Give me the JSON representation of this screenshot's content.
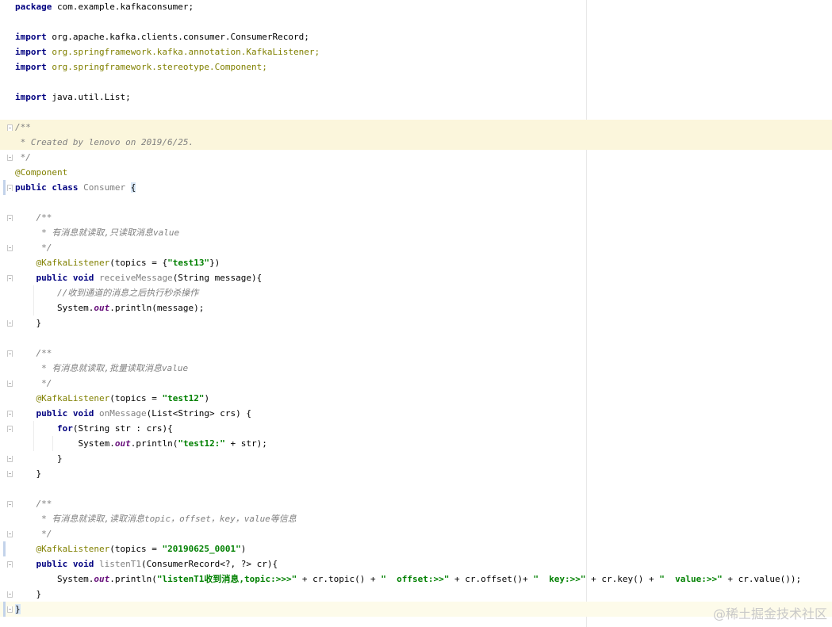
{
  "editor": {
    "lines": [
      [
        {
          "t": "package ",
          "c": "kw"
        },
        {
          "t": "com.example.kafkaconsumer;",
          "c": "plain"
        }
      ],
      [],
      [
        {
          "t": "import ",
          "c": "kw"
        },
        {
          "t": "org.apache.kafka.clients.consumer.ConsumerRecord;",
          "c": "plain"
        }
      ],
      [
        {
          "t": "import ",
          "c": "kw"
        },
        {
          "t": "org.springframework.kafka.annotation.KafkaListener;",
          "c": "anno"
        }
      ],
      [
        {
          "t": "import ",
          "c": "kw"
        },
        {
          "t": "org.springframework.stereotype.Component;",
          "c": "anno"
        }
      ],
      [],
      [
        {
          "t": "import ",
          "c": "kw"
        },
        {
          "t": "java.util.List;",
          "c": "plain"
        }
      ],
      [],
      [
        {
          "t": "/**",
          "c": "comment"
        }
      ],
      [
        {
          "t": " * Created by lenovo on 2019/6/25.",
          "c": "comment"
        }
      ],
      [
        {
          "t": " */",
          "c": "comment"
        }
      ],
      [
        {
          "t": "@Component",
          "c": "anno"
        }
      ],
      [
        {
          "t": "public class ",
          "c": "kw"
        },
        {
          "t": "Consumer ",
          "c": "unused"
        },
        {
          "t": "{",
          "c": "brace"
        }
      ],
      [],
      [
        {
          "t": "    /**",
          "c": "comment"
        }
      ],
      [
        {
          "t": "     * 有消息就读取,只读取消息value",
          "c": "comment"
        }
      ],
      [
        {
          "t": "     */",
          "c": "comment"
        }
      ],
      [
        {
          "t": "    @KafkaListener",
          "c": "anno"
        },
        {
          "t": "(topics = {",
          "c": "plain"
        },
        {
          "t": "\"test13\"",
          "c": "str"
        },
        {
          "t": "})",
          "c": "plain"
        }
      ],
      [
        {
          "t": "    public void ",
          "c": "kw"
        },
        {
          "t": "receiveMessage",
          "c": "unused"
        },
        {
          "t": "(String message){",
          "c": "plain"
        }
      ],
      [
        {
          "t": "        //收到通道的消息之后执行秒杀操作",
          "c": "comment"
        }
      ],
      [
        {
          "t": "        System.",
          "c": "plain"
        },
        {
          "t": "out",
          "c": "static"
        },
        {
          "t": ".println(message);",
          "c": "plain"
        }
      ],
      [
        {
          "t": "    }",
          "c": "plain"
        }
      ],
      [],
      [
        {
          "t": "    /**",
          "c": "comment"
        }
      ],
      [
        {
          "t": "     * 有消息就读取,批量读取消息value",
          "c": "comment"
        }
      ],
      [
        {
          "t": "     */",
          "c": "comment"
        }
      ],
      [
        {
          "t": "    @KafkaListener",
          "c": "anno"
        },
        {
          "t": "(topics = ",
          "c": "plain"
        },
        {
          "t": "\"test12\"",
          "c": "str"
        },
        {
          "t": ")",
          "c": "plain"
        }
      ],
      [
        {
          "t": "    public void ",
          "c": "kw"
        },
        {
          "t": "onMessage",
          "c": "unused"
        },
        {
          "t": "(List<String> crs) {",
          "c": "plain"
        }
      ],
      [
        {
          "t": "        ",
          "c": "plain"
        },
        {
          "t": "for",
          "c": "kw"
        },
        {
          "t": "(String str : crs){",
          "c": "plain"
        }
      ],
      [
        {
          "t": "            System.",
          "c": "plain"
        },
        {
          "t": "out",
          "c": "static"
        },
        {
          "t": ".println(",
          "c": "plain"
        },
        {
          "t": "\"test12:\"",
          "c": "str"
        },
        {
          "t": " + str);",
          "c": "plain"
        }
      ],
      [
        {
          "t": "        }",
          "c": "plain"
        }
      ],
      [
        {
          "t": "    }",
          "c": "plain"
        }
      ],
      [],
      [
        {
          "t": "    /**",
          "c": "comment"
        }
      ],
      [
        {
          "t": "     * 有消息就读取,读取消息topic，offset，key，value等信息",
          "c": "comment"
        }
      ],
      [
        {
          "t": "     */",
          "c": "comment"
        }
      ],
      [
        {
          "t": "    @KafkaListener",
          "c": "anno"
        },
        {
          "t": "(topics = ",
          "c": "plain"
        },
        {
          "t": "\"20190625_0001\"",
          "c": "str"
        },
        {
          "t": ")",
          "c": "plain"
        }
      ],
      [
        {
          "t": "    public void ",
          "c": "kw"
        },
        {
          "t": "listenT1",
          "c": "unused"
        },
        {
          "t": "(ConsumerRecord<?, ?> cr){",
          "c": "plain"
        }
      ],
      [
        {
          "t": "        System.",
          "c": "plain"
        },
        {
          "t": "out",
          "c": "static"
        },
        {
          "t": ".println(",
          "c": "plain"
        },
        {
          "t": "\"listenT1收到消息,topic:>>>\"",
          "c": "str"
        },
        {
          "t": " + cr.topic() + ",
          "c": "plain"
        },
        {
          "t": "\"  offset:>>\"",
          "c": "str"
        },
        {
          "t": " + cr.offset()+ ",
          "c": "plain"
        },
        {
          "t": "\"  key:>>\"",
          "c": "str"
        },
        {
          "t": " + cr.key() + ",
          "c": "plain"
        },
        {
          "t": "\"  value:>>\"",
          "c": "str"
        },
        {
          "t": " + cr.value());",
          "c": "plain"
        }
      ],
      [
        {
          "t": "    }",
          "c": "plain"
        }
      ],
      [
        {
          "t": "}",
          "c": "brace"
        }
      ]
    ]
  },
  "watermark": "@稀土掘金技术社区",
  "colors": {
    "keyword": "#000080",
    "comment": "#808080",
    "annotation": "#808000",
    "string": "#008000",
    "highlight": "#fbf6dc"
  },
  "icons": [
    "fold-marker-icon"
  ]
}
